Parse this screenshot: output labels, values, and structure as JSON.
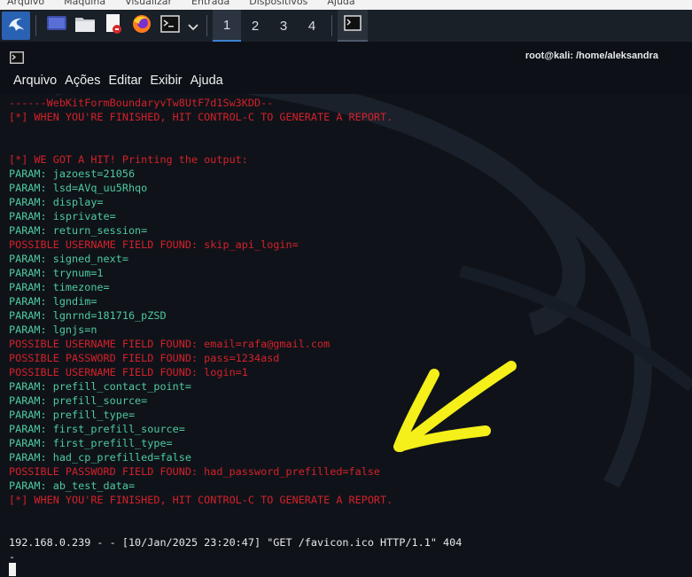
{
  "host_menu": [
    "Arquivo",
    "Máquina",
    "Visualizar",
    "Entrada",
    "Dispositivos",
    "Ajuda"
  ],
  "taskbar": {
    "icons": [
      "kali-menu-icon",
      "desktop-icon",
      "file-manager-icon",
      "text-editor-icon",
      "firefox-icon",
      "terminal-icon",
      "dropdown-icon"
    ],
    "workspaces": [
      "1",
      "2",
      "3",
      "4"
    ],
    "active_workspace": "1"
  },
  "window": {
    "title": "root@kali: /home/aleksandra",
    "menu": [
      "Arquivo",
      "Ações",
      "Editar",
      "Exibir",
      "Ajuda"
    ]
  },
  "terminal": {
    "lines": [
      {
        "text": "------WebKitFormBoundaryvTw8UtF7d1Sw3KDD--",
        "color": "red"
      },
      {
        "text": "[*] WHEN YOU'RE FINISHED, HIT CONTROL-C TO GENERATE A REPORT.",
        "color": "red"
      },
      {
        "text": "",
        "color": "white"
      },
      {
        "text": "",
        "color": "white"
      },
      {
        "text": "[*] WE GOT A HIT! Printing the output:",
        "color": "red"
      },
      {
        "text": "PARAM: jazoest=21056",
        "color": "green"
      },
      {
        "text": "PARAM: lsd=AVq_uu5Rhqo",
        "color": "green"
      },
      {
        "text": "PARAM: display=",
        "color": "green"
      },
      {
        "text": "PARAM: isprivate=",
        "color": "green"
      },
      {
        "text": "PARAM: return_session=",
        "color": "green"
      },
      {
        "text": "POSSIBLE USERNAME FIELD FOUND: skip_api_login=",
        "color": "red"
      },
      {
        "text": "PARAM: signed_next=",
        "color": "green"
      },
      {
        "text": "PARAM: trynum=1",
        "color": "green"
      },
      {
        "text": "PARAM: timezone=",
        "color": "green"
      },
      {
        "text": "PARAM: lgndim=",
        "color": "green"
      },
      {
        "text": "PARAM: lgnrnd=181716_pZSD",
        "color": "green"
      },
      {
        "text": "PARAM: lgnjs=n",
        "color": "green"
      },
      {
        "text": "POSSIBLE USERNAME FIELD FOUND: email=rafa@gmail.com",
        "color": "red"
      },
      {
        "text": "POSSIBLE PASSWORD FIELD FOUND: pass=1234asd",
        "color": "red"
      },
      {
        "text": "POSSIBLE USERNAME FIELD FOUND: login=1",
        "color": "red"
      },
      {
        "text": "PARAM: prefill_contact_point=",
        "color": "green"
      },
      {
        "text": "PARAM: prefill_source=",
        "color": "green"
      },
      {
        "text": "PARAM: prefill_type=",
        "color": "green"
      },
      {
        "text": "PARAM: first_prefill_source=",
        "color": "green"
      },
      {
        "text": "PARAM: first_prefill_type=",
        "color": "green"
      },
      {
        "text": "PARAM: had_cp_prefilled=false",
        "color": "green"
      },
      {
        "text": "POSSIBLE PASSWORD FIELD FOUND: had_password_prefilled=false",
        "color": "red"
      },
      {
        "text": "PARAM: ab_test_data=",
        "color": "green"
      },
      {
        "text": "[*] WHEN YOU'RE FINISHED, HIT CONTROL-C TO GENERATE A REPORT.",
        "color": "red"
      },
      {
        "text": "",
        "color": "white"
      },
      {
        "text": "",
        "color": "white"
      },
      {
        "text": "192.168.0.239 - - [10/Jan/2025 23:20:47] \"GET /favicon.ico HTTP/1.1\" 404",
        "color": "white"
      },
      {
        "text": "-",
        "color": "white"
      }
    ]
  },
  "annotation": {
    "icon": "yellow-arrow-icon",
    "color": "#f5ef1a"
  },
  "colors": {
    "red": "#d4202a",
    "green": "#4ec9a0",
    "white": "#e8e8e8",
    "bg": "#0f1319"
  }
}
